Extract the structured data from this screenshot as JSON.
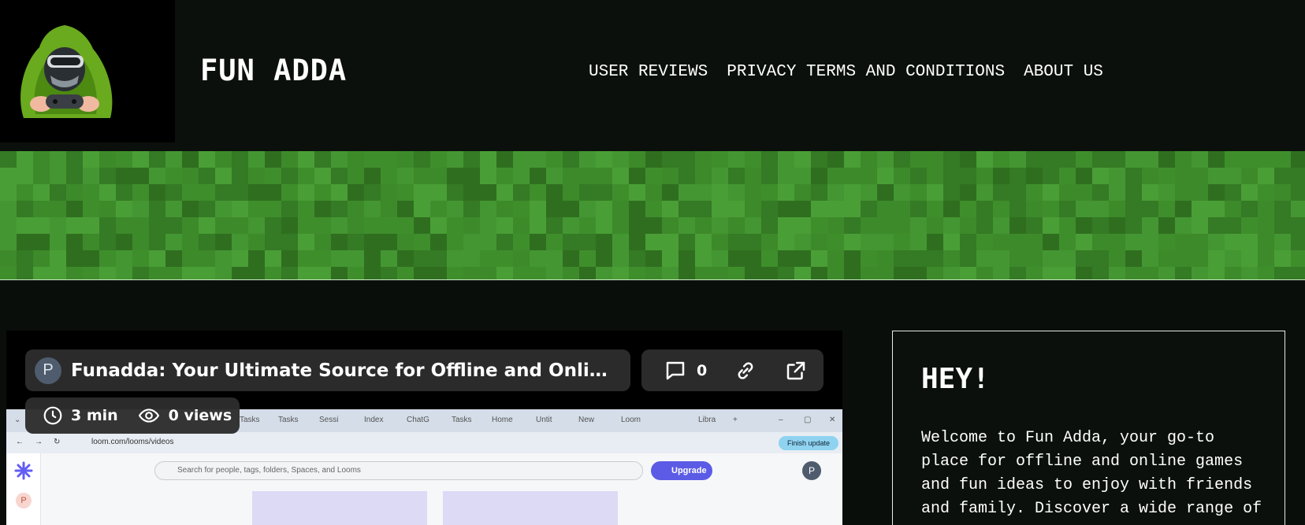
{
  "site": {
    "title": "FUN ADDA"
  },
  "nav": [
    {
      "label": "USER REVIEWS"
    },
    {
      "label": "PRIVACY TERMS AND CONDITIONS"
    },
    {
      "label": "ABOUT US"
    }
  ],
  "video": {
    "avatar_initial": "P",
    "title": "Funadda: Your Ultimate Source for Offline and Online G...",
    "comment_count": "0",
    "duration": "3 min",
    "views": "0 views",
    "screen": {
      "tabs": [
        "Tasks",
        "Tasks",
        "Sessi",
        "Index",
        "ChatG",
        "Tasks",
        "Home",
        "Untit",
        "New",
        "Loom",
        "",
        "Libra"
      ],
      "url": "loom.com/looms/videos",
      "finish_update": "Finish update",
      "search_placeholder": "Search for people, tags, folders, Spaces, and Looms",
      "upgrade_label": "Upgrade",
      "profile_initial": "P",
      "sidebar_initial": "P"
    }
  },
  "sidebar": {
    "heading": "HEY!",
    "text": "Welcome to Fun Adda, your go-to place for offline and online games and fun ideas to enjoy with friends and family. Discover a wide range of"
  },
  "colors": {
    "page_bg": "#0a0e0a",
    "banner_green": "#3d8a2a",
    "pill_bg": "#2d2d2d",
    "upgrade_purple": "#5b5be6"
  }
}
